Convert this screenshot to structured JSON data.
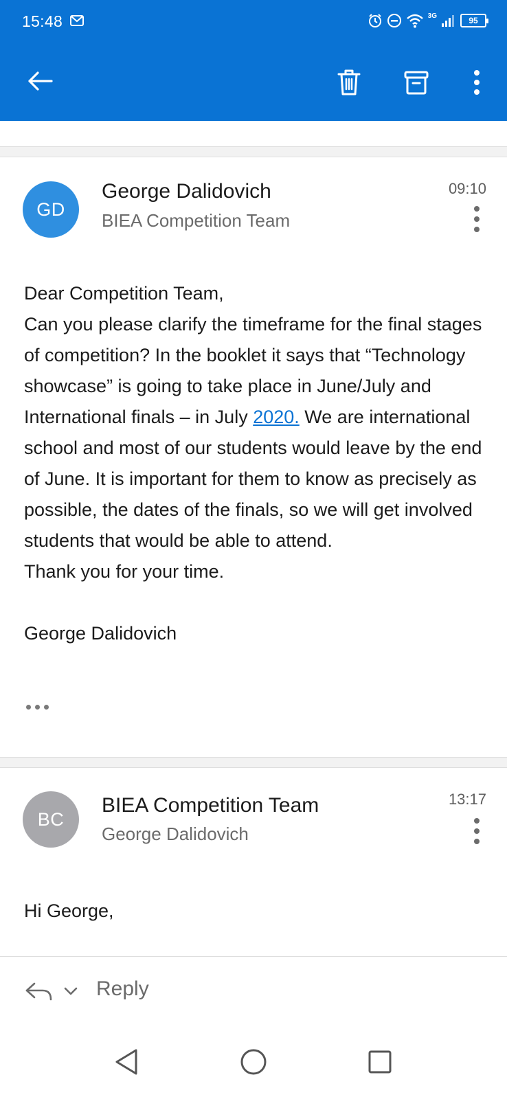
{
  "status_bar": {
    "time": "15:48",
    "network": "3G",
    "battery": "95",
    "icons": [
      "gmail-notification-icon",
      "alarm-icon",
      "do-not-disturb-icon",
      "wifi-icon",
      "signal-icon",
      "battery-icon"
    ]
  },
  "app_bar": {
    "icons": [
      "back-arrow-icon",
      "trash-icon",
      "archive-icon",
      "more-vert-icon"
    ],
    "color": "#0a73d4"
  },
  "messages": [
    {
      "avatar_initials": "GD",
      "avatar_color": "#2f8fe0",
      "sender": "George Dalidovich",
      "recipient": "BIEA Competition Team",
      "time": "09:10",
      "body": {
        "greeting": "Dear Competition Team,",
        "p1_before_link": "Can you please clarify the timeframe for the final stages of competition? In the booklet it says that “Technology showcase” is going to take place in June/July and International finals – in July ",
        "p1_link": "2020.",
        "p1_after_link": " We are international school and most of our students would leave by the end of June. It is important for them to know as precisely as possible, the dates of the finals, so we will get involved students that would be able to attend.",
        "p2": "Thank you for your time.",
        "signature": "George Dalidovich"
      }
    },
    {
      "avatar_initials": "BC",
      "avatar_color": "#a8a8ac",
      "sender": "BIEA Competition Team",
      "recipient": "George Dalidovich",
      "time": "13:17",
      "body": {
        "greeting": "Hi George,"
      }
    }
  ],
  "reply_bar": {
    "label": "Reply",
    "icons": [
      "reply-icon",
      "chevron-down-icon"
    ]
  },
  "nav_bar": {
    "icons": [
      "back-triangle-icon",
      "home-circle-icon",
      "recents-square-icon"
    ]
  }
}
